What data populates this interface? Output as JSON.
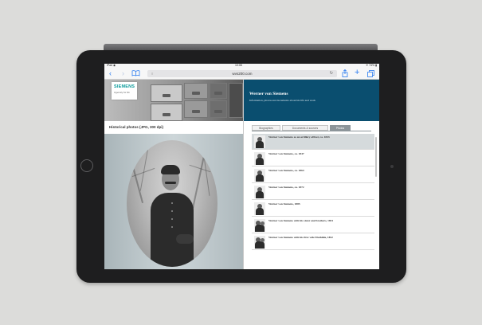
{
  "status_bar": {
    "left": "iPad ◉",
    "time": "10:08",
    "right": "✳ 74% ▮"
  },
  "browser": {
    "url": "wvs200.com",
    "icons": {
      "back": "chevron-left-icon",
      "forward": "chevron-right-icon",
      "bookmarks": "book-icon",
      "share": "share-icon",
      "new_tab": "plus-icon",
      "tabs": "tabs-icon"
    }
  },
  "left_panel": {
    "logo": {
      "name": "SIEMENS",
      "tagline": "Ingenuity for life"
    },
    "photos_title": "Historical photos (JPG, 300 dpi)"
  },
  "right_panel": {
    "title": "Werner von Siemens",
    "subtitle": "Information, photos and documents about his life and work",
    "tabs": [
      {
        "label": "Biographies",
        "active": false
      },
      {
        "label": "Documents & sources",
        "active": false
      },
      {
        "label": "Photos",
        "active": true
      }
    ],
    "photos": [
      {
        "caption": "Werner von Siemens as an artillery officer, ca. 1843",
        "active": true
      },
      {
        "caption": "Werner von Siemens, ca. 1847",
        "active": false
      },
      {
        "caption": "Werner von Siemens, ca. 1864",
        "active": false
      },
      {
        "caption": "Werner von Siemens, ca. 1872",
        "active": false
      },
      {
        "caption": "Werner von Siemens, 1885",
        "active": false
      },
      {
        "caption": "Werner von Siemens with his sister and brothers, 1851",
        "active": false
      },
      {
        "caption": "Werner von Siemens with his first wife Mathilde, 1852",
        "active": false
      }
    ]
  },
  "colors": {
    "accent": "#0a4e6f",
    "tab_active": "#8c959a",
    "safari_blue": "#2a7bf0",
    "logo_teal": "#0a9a9a"
  }
}
